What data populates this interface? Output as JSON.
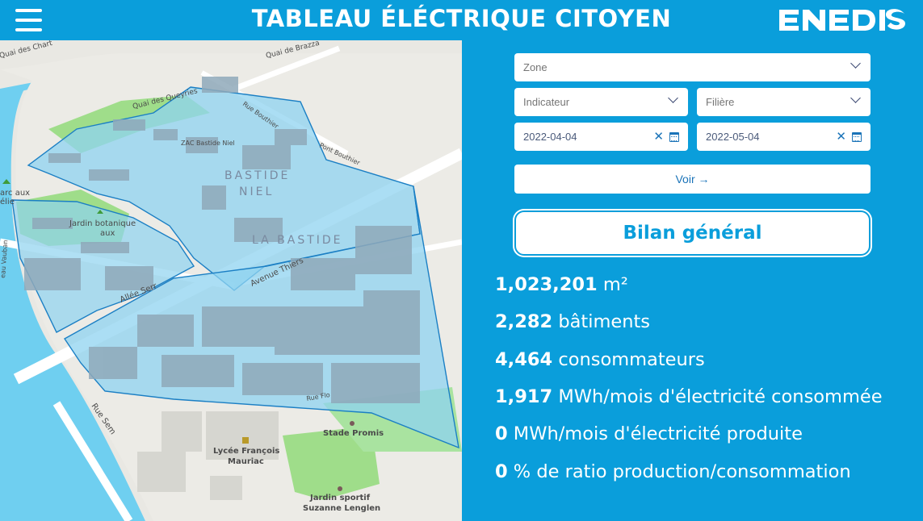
{
  "header": {
    "title": "TABLEAU ÉLÉCTRIQUE CITOYEN",
    "logo_text": "ENEDIS",
    "menu_icon": "hamburger-menu-icon"
  },
  "map": {
    "labels": {
      "quai_brazza": "Quai de Brazza",
      "quai_des_chartrons": "Quai des Chart",
      "quai_queyries": "Quai des Queyries",
      "rue_bouthier": "Rue Bouthier",
      "pont_bouthier": "Pont Bouthier",
      "zac": "ZAC Bastide Niel",
      "bastide_niel_1": "BASTIDE",
      "bastide_niel_2": "NIEL",
      "la_bastide": "LA BASTIDE",
      "arc_aux": "arc aux",
      "arc_aux_2": "élie",
      "jardin_botanique_1": "Jardin botanique",
      "jardin_botanique_2": "aux",
      "avenue_thiers": "Avenue Thiers",
      "allee_serr": "Allée Serr",
      "rue_sem": "Rue Sem",
      "rue_flo": "Rue Flo",
      "stade_promis": "Stade Promis",
      "lycee_1": "Lycée François",
      "lycee_2": "Mauriac",
      "jardin_sportif_1": "Jardin sportif",
      "jardin_sportif_2": "Suzanne Lenglen",
      "quai_left": "eau Vauban"
    }
  },
  "filters": {
    "zone_placeholder": "Zone",
    "indicateur_placeholder": "Indicateur",
    "filiere_placeholder": "Filière",
    "date_start": "2022-04-04",
    "date_end": "2022-05-04",
    "clear_glyph": "✕",
    "voir_label": "Voir →"
  },
  "bilan": {
    "button_label": "Bilan général"
  },
  "stats": [
    {
      "value": "1,023,201",
      "label": " m²"
    },
    {
      "value": "2,282",
      "label": " bâtiments"
    },
    {
      "value": "4,464",
      "label": " consommateurs"
    },
    {
      "value": "1,917",
      "label": " MWh/mois d'électricité consommée"
    },
    {
      "value": "0",
      "label": " MWh/mois d'électricité produite"
    },
    {
      "value": "0",
      "label": " % de ratio production/consommation"
    }
  ],
  "colors": {
    "brand_blue": "#0a9edb",
    "river": "#6fcff0",
    "zone_fill": "#8fd3f0",
    "zone_stroke": "#1b7fc4",
    "park": "#9fdd8a"
  }
}
